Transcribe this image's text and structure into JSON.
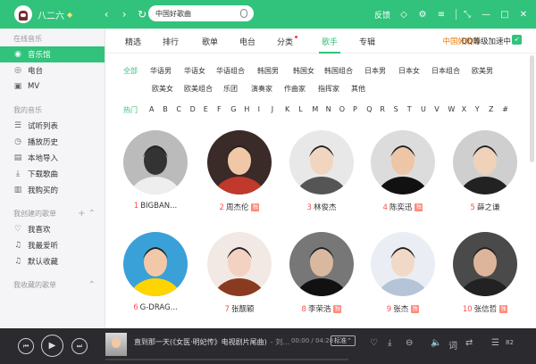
{
  "titlebar": {
    "username": "八二六",
    "search_placeholder": "中国好歌曲",
    "feedback": "反馈"
  },
  "sidebar": {
    "sections": [
      {
        "title": "在线音乐",
        "items": [
          {
            "label": "音乐馆",
            "icon": "music-hall-icon",
            "active": true
          },
          {
            "label": "电台",
            "icon": "radio-icon"
          },
          {
            "label": "MV",
            "icon": "mv-icon"
          }
        ]
      },
      {
        "title": "我的音乐",
        "items": [
          {
            "label": "试听列表",
            "icon": "playlist-icon"
          },
          {
            "label": "播放历史",
            "icon": "history-icon"
          },
          {
            "label": "本地导入",
            "icon": "local-import-icon"
          },
          {
            "label": "下载歌曲",
            "icon": "download-icon"
          },
          {
            "label": "我购买的",
            "icon": "purchased-icon"
          }
        ]
      },
      {
        "title": "我创建的歌单",
        "items": [
          {
            "label": "我喜欢",
            "icon": "heart-icon"
          },
          {
            "label": "我最爱听",
            "icon": "note-icon"
          },
          {
            "label": "默认收藏",
            "icon": "note-icon"
          }
        ]
      },
      {
        "title": "我收藏的歌单",
        "items": []
      }
    ]
  },
  "tabs": [
    "精选",
    "排行",
    "歌单",
    "电台",
    "分类",
    "歌手",
    "专辑"
  ],
  "active_tab": "歌手",
  "promo_text": "中国好歌曲",
  "qq_text": "QQ等级加速中",
  "filters_row1": [
    "全部",
    "华语男",
    "华语女",
    "华语组合",
    "韩国男",
    "韩国女",
    "韩国组合",
    "日本男",
    "日本女",
    "日本组合",
    "欧美男"
  ],
  "filters_row2": [
    "欧美女",
    "欧美组合",
    "乐团",
    "演奏家",
    "作曲家",
    "指挥家",
    "其他"
  ],
  "letters": [
    "热门",
    "A",
    "B",
    "C",
    "D",
    "E",
    "F",
    "G",
    "H",
    "I",
    "J",
    "K",
    "L",
    "M",
    "N",
    "O",
    "P",
    "Q",
    "R",
    "S",
    "T",
    "U",
    "V",
    "W",
    "X",
    "Y",
    "Z",
    "#"
  ],
  "artists": [
    {
      "rank": "1",
      "name": "BIGBAN...",
      "mark": false
    },
    {
      "rank": "2",
      "name": "周杰伦",
      "mark": true
    },
    {
      "rank": "3",
      "name": "林俊杰",
      "mark": false
    },
    {
      "rank": "4",
      "name": "陈奕迅",
      "mark": true
    },
    {
      "rank": "5",
      "name": "薛之谦",
      "mark": false
    },
    {
      "rank": "6",
      "name": "G-DRAG...",
      "mark": false
    },
    {
      "rank": "7",
      "name": "张靓颖",
      "mark": false
    },
    {
      "rank": "8",
      "name": "李荣浩",
      "mark": true
    },
    {
      "rank": "9",
      "name": "张杰",
      "mark": true
    },
    {
      "rank": "10",
      "name": "张信哲",
      "mark": true
    }
  ],
  "artist_mark_label": "独",
  "player": {
    "song": "直到那一天(《女医·明妃传》电视剧片尾曲)",
    "singer": "- 刘…",
    "time": "00:00 / 04:28",
    "quality": "标准",
    "lyrics_label": "词",
    "count": "82"
  },
  "colors": {
    "accent": "#31c27c",
    "player_bg": "#2b2b2f",
    "sidebar_bg": "#f5f5f7"
  }
}
